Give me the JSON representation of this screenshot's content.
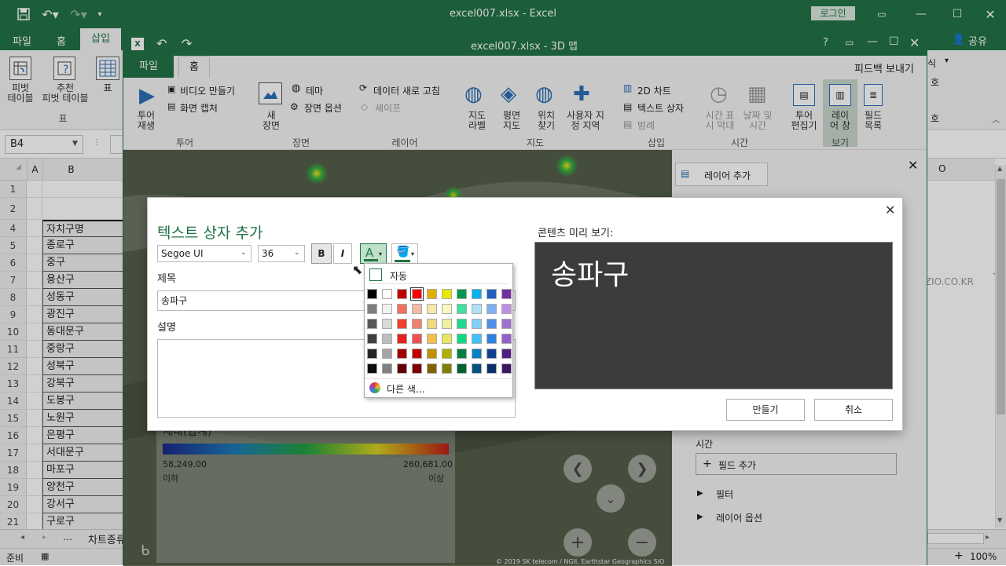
{
  "excel": {
    "title": "excel007.xlsx - Excel",
    "login_label": "로그인",
    "tabs": [
      "파일",
      "홈",
      "삽입"
    ],
    "share_label": "공유",
    "ribbon": {
      "pivot_table": "피벗\n테이블",
      "recommended_pivot": "추천\n피벗 테이블",
      "table": "표",
      "group_table": "표",
      "right_fragment_1": "식",
      "right_fragment_2": "호",
      "right_fragment_3": "호"
    },
    "name_box": "B4",
    "columns": [
      "A",
      "B"
    ],
    "col_o": "O",
    "rows": [
      {
        "num": "1",
        "b": ""
      },
      {
        "num": "2",
        "b": ""
      },
      {
        "num": "4",
        "b": "자치구명"
      },
      {
        "num": "5",
        "b": "종로구"
      },
      {
        "num": "6",
        "b": "중구"
      },
      {
        "num": "7",
        "b": "용산구"
      },
      {
        "num": "8",
        "b": "성동구"
      },
      {
        "num": "9",
        "b": "광진구"
      },
      {
        "num": "10",
        "b": "동대문구"
      },
      {
        "num": "11",
        "b": "중랑구"
      },
      {
        "num": "12",
        "b": "성북구"
      },
      {
        "num": "13",
        "b": "강북구"
      },
      {
        "num": "14",
        "b": "도봉구"
      },
      {
        "num": "15",
        "b": "노원구"
      },
      {
        "num": "16",
        "b": "은평구"
      },
      {
        "num": "17",
        "b": "서대문구"
      },
      {
        "num": "18",
        "b": "마포구"
      },
      {
        "num": "19",
        "b": "양천구"
      },
      {
        "num": "20",
        "b": "강서구"
      },
      {
        "num": "21",
        "b": "구로구"
      }
    ],
    "sheet_tab": "차트종류",
    "status_ready": "준비",
    "zoom": "100%",
    "watermark": "ALZIO.CO.KR"
  },
  "maps": {
    "title": "excel007.xlsx - 3D 맵",
    "feedback": "피드백 보내기",
    "tabs": [
      "파일",
      "홈"
    ],
    "ribbon": {
      "tour_play": "투어\n재생",
      "video": "비디오 만들기",
      "capture": "화면 캡처",
      "new_scene": "새\n장면",
      "theme": "테마",
      "scene_options": "장면 옵션",
      "refresh": "데이터 새로 고침",
      "shapes": "셰이프",
      "map_labels": "지도\n라벨",
      "flat_map": "평면\n지도",
      "find_location": "위치\n찾기",
      "custom_regions": "사용자 지\n정 지역",
      "chart_2d": "2D 차트",
      "text_box": "텍스트 상자",
      "legend": "범례",
      "time_line": "시간 표\n시 막대",
      "date_time": "날짜 및\n시간",
      "tour_editor": "투어\n편집기",
      "layer_pane": "레이\n어 창",
      "field_list": "필드\n목록",
      "groups": [
        "투어",
        "장면",
        "레이어",
        "지도",
        "삽입",
        "시간",
        "보기"
      ]
    },
    "legend": {
      "title": "세대(합계)",
      "min_value": "58,249.00",
      "max_value": "260,681.00",
      "min_label": "이하",
      "max_label": "이상"
    },
    "copyright": "© 2019 SK telecom / NGII, Earthstar Geographics  SIO",
    "pane": {
      "add_layer": "레이어 추가",
      "time_label": "시간",
      "add_field": "필드 추가",
      "filter": "필터",
      "layer_options": "레이어 옵션"
    }
  },
  "dialog": {
    "title": "텍스트 상자 추가",
    "font_name": "Segoe UI",
    "font_size": "36",
    "bold": "B",
    "italic": "I",
    "font_color_glyph": "A",
    "title_label": "제목",
    "title_value": "송파구",
    "desc_label": "설명",
    "desc_value": "",
    "preview_label": "콘텐츠 미리 보기:",
    "preview_text": "송파구",
    "create_button": "만들기",
    "cancel_button": "취소"
  },
  "color_menu": {
    "auto_label": "자동",
    "more_colors": "다른 색...",
    "swatches": [
      [
        "#000000",
        "#ffffff",
        "#c00000",
        "#ff0000",
        "#e0b000",
        "#e8e800",
        "#009850",
        "#00b0f0",
        "#2060c0",
        "#7030a0"
      ],
      [
        "#7f7f7f",
        "#f2f2f2",
        "#f07060",
        "#f8b8a8",
        "#f8e8a8",
        "#f8f8c0",
        "#40e0a0",
        "#b0e0f8",
        "#80b0f0",
        "#c090e0"
      ],
      [
        "#595959",
        "#d9d9d9",
        "#f04030",
        "#f08070",
        "#f0d880",
        "#f0f0a0",
        "#20d890",
        "#80d0f8",
        "#5090e8",
        "#a070d0"
      ],
      [
        "#404040",
        "#bfbfbf",
        "#e82020",
        "#f05050",
        "#f0c050",
        "#e8e860",
        "#10d880",
        "#40c0f8",
        "#3080e0",
        "#9060c8"
      ],
      [
        "#262626",
        "#a6a6a6",
        "#a00000",
        "#c00000",
        "#c09000",
        "#b0b000",
        "#008040",
        "#0080c0",
        "#104090",
        "#502080"
      ],
      [
        "#0d0d0d",
        "#808080",
        "#600000",
        "#800000",
        "#806000",
        "#808000",
        "#006030",
        "#005080",
        "#0c2f6b",
        "#3d1760"
      ]
    ],
    "selected": [
      0,
      3
    ]
  },
  "colors": {
    "excel_green": "#217346",
    "dialog_title": "#1e7145",
    "preview_bg": "#3c3c3c"
  }
}
